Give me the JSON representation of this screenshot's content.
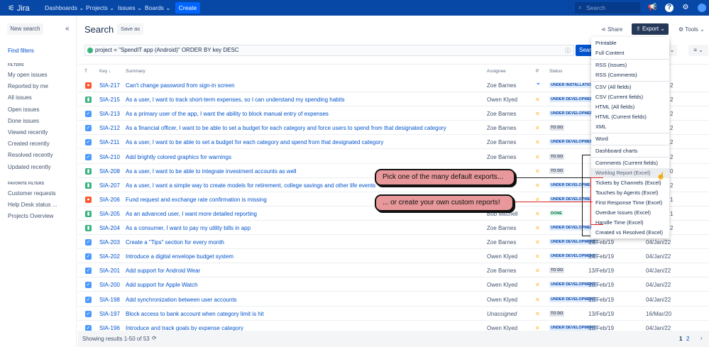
{
  "topbar": {
    "logo": "Jira",
    "nav": [
      "Dashboards",
      "Projects",
      "Issues",
      "Boards"
    ],
    "create": "Create",
    "search_placeholder": "Search"
  },
  "sidebar": {
    "new_search": "New search",
    "find_filters": "Find filters",
    "filters_header": "FILTERS",
    "filters": [
      "My open issues",
      "Reported by me",
      "All issues",
      "Open issues",
      "Done issues",
      "Viewed recently",
      "Created recently",
      "Resolved recently",
      "Updated recently"
    ],
    "favorites_header": "FAVORITE FILTERS",
    "favorites": [
      "Customer requests",
      "Help Desk status ...",
      "Projects Overview"
    ]
  },
  "header": {
    "title": "Search",
    "save_as": "Save as",
    "share": "Share",
    "export": "Export",
    "tools": "Tools",
    "search_button": "Search"
  },
  "jql": "project = \"SpendIT app (Android)\" ORDER BY key DESC",
  "columns": {
    "t": "T",
    "key": "Key",
    "summary": "Summary",
    "assignee": "Assignee",
    "p": "P",
    "status": "Status"
  },
  "rows": [
    {
      "type": "bug",
      "key": "SIA-217",
      "summary": "Can't change password from sign-in screen",
      "assignee": "Zoe Barnes",
      "priority": "low",
      "status": "UNDER INSTALLATION",
      "sc": "ud",
      "tail": "2"
    },
    {
      "type": "story",
      "key": "SIA-215",
      "summary": "As a user, I want to track short-term expenses, so I can understand my spending habits",
      "assignee": "Owen Klyed",
      "priority": "medium",
      "status": "UNDER DEVELOPMENT",
      "sc": "ud",
      "tail": "2"
    },
    {
      "type": "task",
      "key": "SIA-213",
      "summary": "As a primary user of the app, I want the ability to block manual entry of expenses",
      "assignee": "Zoe Barnes",
      "priority": "medium",
      "status": "UNDER DEVELOPMENT",
      "sc": "ud",
      "tail": "2"
    },
    {
      "type": "task",
      "key": "SIA-212",
      "summary": "As a financial officer, I want to be able to set a budget for each category and force users to spend from that designated category",
      "assignee": "Zoe Barnes",
      "priority": "medium",
      "status": "TO DO",
      "sc": "td",
      "tail": "2"
    },
    {
      "type": "task",
      "key": "SIA-211",
      "summary": "As a user, I want to be able to set a budget for each category and spend from that designated category",
      "assignee": "Zoe Barnes",
      "priority": "medium",
      "status": "UNDER DEVELOPMENT",
      "sc": "ud",
      "tail": "2"
    },
    {
      "type": "task",
      "key": "SIA-210",
      "summary": "Add brightly colored graphics for warnings",
      "assignee": "Zoe Barnes",
      "priority": "medium",
      "status": "TO DO",
      "sc": "td",
      "tail": "2"
    },
    {
      "type": "story",
      "key": "SIA-208",
      "summary": "As a user, I want to be able to integrate investment accounts as well",
      "assignee": "",
      "priority": "medium",
      "status": "TO DO",
      "sc": "td",
      "tail": "0"
    },
    {
      "type": "story",
      "key": "SIA-207",
      "summary": "As a user, I want a simple way to create models for retirement, college savings and other life events",
      "assignee": "",
      "priority": "medium",
      "status": "UNDER DEVELOPMENT",
      "sc": "ud",
      "tail": "2"
    },
    {
      "type": "bug",
      "key": "SIA-206",
      "summary": "Fund request and exchange rate confirmation is missing",
      "assignee": "bo",
      "priority": "medium",
      "status": "UNDER DEVELOPMENT",
      "sc": "ud",
      "tail": "1"
    },
    {
      "type": "story",
      "key": "SIA-205",
      "summary": "As an advanced user, I want more detailed reporting",
      "assignee": "Bob Mitchell",
      "priority": "medium",
      "status": "DONE",
      "sc": "dn",
      "tail": "1"
    },
    {
      "type": "story",
      "key": "SIA-204",
      "summary": "As a consumer, I want to pay my utility bills in app",
      "assignee": "Zoe Barnes",
      "priority": "medium",
      "status": "UNDER DEVELOPMENT",
      "sc": "ud",
      "tail": "2"
    },
    {
      "type": "task",
      "key": "SIA-203",
      "summary": "Create a \"Tips\" section for every month",
      "assignee": "Zoe Barnes",
      "priority": "medium",
      "status": "UNDER DEVELOPMENT",
      "sc": "ud",
      "created": "14/Feb/19",
      "updated": "04/Jan/22"
    },
    {
      "type": "task",
      "key": "SIA-202",
      "summary": "Introduce a digital envelope budget system",
      "assignee": "Owen Klyed",
      "priority": "medium",
      "status": "UNDER DEVELOPMENT",
      "sc": "ud",
      "created": "14/Feb/19",
      "updated": "04/Jan/22"
    },
    {
      "type": "task",
      "key": "SIA-201",
      "summary": "Add support for Android Wear",
      "assignee": "Zoe Barnes",
      "priority": "medium",
      "status": "TO DO",
      "sc": "td",
      "created": "13/Feb/19",
      "updated": "04/Jan/22"
    },
    {
      "type": "task",
      "key": "SIA-200",
      "summary": "Add support for Apple Watch",
      "assignee": "Owen Klyed",
      "priority": "medium",
      "status": "UNDER DEVELOPMENT",
      "sc": "ud",
      "created": "13/Feb/19",
      "updated": "04/Jan/22"
    },
    {
      "type": "task",
      "key": "SIA-198",
      "summary": "Add synchronization between user accounts",
      "assignee": "Owen Klyed",
      "priority": "medium",
      "status": "UNDER DEVELOPMENT",
      "sc": "ud",
      "created": "13/Feb/19",
      "updated": "04/Jan/22"
    },
    {
      "type": "task",
      "key": "SIA-197",
      "summary": "Block access to bank account when category limit is hit",
      "assignee": "Unassigned",
      "priority": "medium",
      "status": "TO DO",
      "sc": "td",
      "created": "13/Feb/19",
      "updated": "16/Mar/20"
    },
    {
      "type": "task",
      "key": "SIA-196",
      "summary": "Introduce and track goals by expense category",
      "assignee": "Owen Klyed",
      "priority": "medium",
      "status": "UNDER DEVELOPMENT",
      "sc": "ud",
      "created": "13/Feb/19",
      "updated": "04/Jan/22"
    }
  ],
  "footer": {
    "showing": "Showing results 1-50 of 53",
    "pages": [
      "1",
      "2"
    ]
  },
  "export_menu": [
    [
      "Printable",
      "Full Content"
    ],
    [
      "RSS (Issues)",
      "RSS (Comments)"
    ],
    [
      "CSV (All fields)",
      "CSV (Current fields)",
      "HTML (All fields)",
      "HTML (Current fields)",
      "XML"
    ],
    [
      "Word"
    ],
    [
      "Dashboard charts"
    ],
    [
      "Comments (Current fields)",
      "Worklog Report (Excel)",
      "Tickets by Channels (Excel)",
      "Touches by Agents (Excel)",
      "First Response Time (Excel)",
      "Overdue Issues (Excel)",
      "Handle Time (Excel)",
      "Created vs Resolved (Excel)"
    ]
  ],
  "callouts": [
    "Pick one of the many default exports...",
    "... or create your own custom reports!"
  ],
  "colors": {
    "nav": "#0747A6",
    "callout": "#E8989A",
    "link": "#0052CC"
  }
}
